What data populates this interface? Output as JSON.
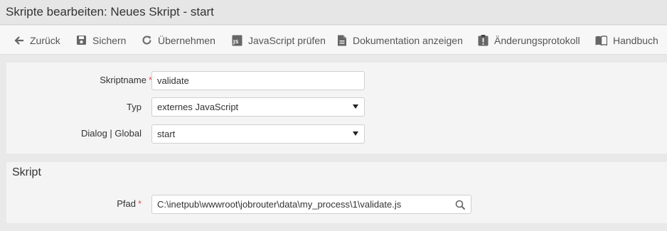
{
  "window": {
    "title": "Skripte bearbeiten: Neues Skript - start"
  },
  "toolbar": {
    "back_label": "Zurück",
    "save_label": "Sichern",
    "apply_label": "Übernehmen",
    "check_js_label": "JavaScript prüfen",
    "docs_label": "Dokumentation anzeigen",
    "changelog_label": "Änderungsprotokoll",
    "manual_label": "Handbuch"
  },
  "form": {
    "script_name_label": "Skriptname",
    "script_name_value": "validate",
    "type_label": "Typ",
    "type_value": "externes JavaScript",
    "dialog_label": "Dialog | Global",
    "dialog_value": "start",
    "required_marker": "*"
  },
  "script_section": {
    "title": "Skript",
    "path_label": "Pfad",
    "path_value": "C:\\inetpub\\wwwroot\\jobrouter\\data\\my_process\\1\\validate.js"
  },
  "colors": {
    "required": "#d9534f",
    "icon": "#666666"
  }
}
